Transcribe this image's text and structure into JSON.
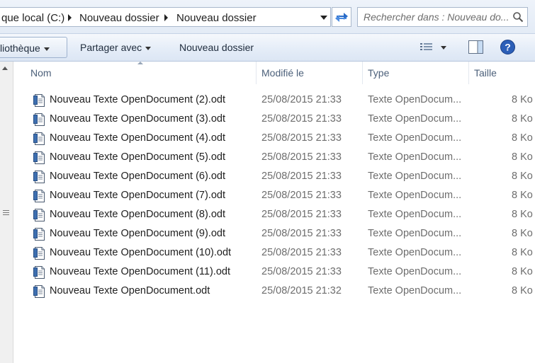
{
  "address_bar": {
    "crumbs": [
      "que local (C:)",
      "Nouveau dossier",
      "Nouveau dossier"
    ]
  },
  "search": {
    "placeholder": "Rechercher dans : Nouveau do..."
  },
  "toolbar": {
    "library_label": "liothèque",
    "share_label": "Partager avec",
    "new_folder_label": "Nouveau dossier"
  },
  "columns": {
    "name": "Nom",
    "modified": "Modifié le",
    "type": "Type",
    "size": "Taille"
  },
  "files": [
    {
      "name": "Nouveau Texte OpenDocument (2).odt",
      "modified": "25/08/2015 21:33",
      "type": "Texte OpenDocum...",
      "size": "8 Ko"
    },
    {
      "name": "Nouveau Texte OpenDocument (3).odt",
      "modified": "25/08/2015 21:33",
      "type": "Texte OpenDocum...",
      "size": "8 Ko"
    },
    {
      "name": "Nouveau Texte OpenDocument (4).odt",
      "modified": "25/08/2015 21:33",
      "type": "Texte OpenDocum...",
      "size": "8 Ko"
    },
    {
      "name": "Nouveau Texte OpenDocument (5).odt",
      "modified": "25/08/2015 21:33",
      "type": "Texte OpenDocum...",
      "size": "8 Ko"
    },
    {
      "name": "Nouveau Texte OpenDocument (6).odt",
      "modified": "25/08/2015 21:33",
      "type": "Texte OpenDocum...",
      "size": "8 Ko"
    },
    {
      "name": "Nouveau Texte OpenDocument (7).odt",
      "modified": "25/08/2015 21:33",
      "type": "Texte OpenDocum...",
      "size": "8 Ko"
    },
    {
      "name": "Nouveau Texte OpenDocument (8).odt",
      "modified": "25/08/2015 21:33",
      "type": "Texte OpenDocum...",
      "size": "8 Ko"
    },
    {
      "name": "Nouveau Texte OpenDocument (9).odt",
      "modified": "25/08/2015 21:33",
      "type": "Texte OpenDocum...",
      "size": "8 Ko"
    },
    {
      "name": "Nouveau Texte OpenDocument (10).odt",
      "modified": "25/08/2015 21:33",
      "type": "Texte OpenDocum...",
      "size": "8 Ko"
    },
    {
      "name": "Nouveau Texte OpenDocument (11).odt",
      "modified": "25/08/2015 21:33",
      "type": "Texte OpenDocum...",
      "size": "8 Ko"
    },
    {
      "name": "Nouveau Texte OpenDocument.odt",
      "modified": "25/08/2015 21:32",
      "type": "Texte OpenDocum...",
      "size": "8 Ko"
    }
  ],
  "icons": {
    "refresh": "refresh-icon",
    "view_options": "details-view-icon",
    "preview_pane": "preview-pane-icon",
    "help": "help-icon",
    "file": "odt-document-icon"
  },
  "colors": {
    "toolbar_bg": "#dfe8f4",
    "help_blue": "#2c5fb8",
    "header_text": "#4c607a"
  }
}
